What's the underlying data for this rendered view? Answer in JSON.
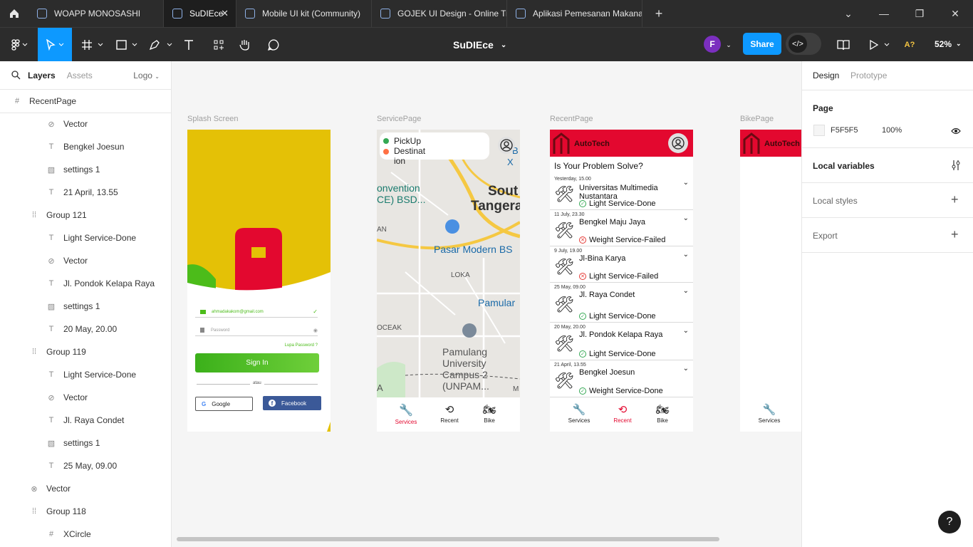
{
  "tabs": [
    {
      "label": "WOAPP MONOSASHI",
      "active": false
    },
    {
      "label": "SuDIEce",
      "active": true
    },
    {
      "label": "Mobile UI kit (Community)",
      "active": false
    },
    {
      "label": "GOJEK UI Design - Online Tra",
      "active": false
    },
    {
      "label": "Aplikasi Pemesanan Makanan",
      "active": false
    }
  ],
  "toolbar": {
    "doc_title": "SuDIEce",
    "avatar_initial": "F",
    "share_label": "Share",
    "zoom": "52%",
    "font_warning": "A?"
  },
  "left_panel": {
    "tab_layers": "Layers",
    "tab_assets": "Assets",
    "page_name": "Logo",
    "layers": [
      {
        "label": "RecentPage",
        "icon": "frame-icon",
        "indent": 0
      },
      {
        "label": "Vector",
        "icon": "check-circle-icon",
        "indent": 2
      },
      {
        "label": "Bengkel Joesun",
        "icon": "text-icon",
        "indent": 2
      },
      {
        "label": "settings 1",
        "icon": "image-icon",
        "indent": 2
      },
      {
        "label": "21 April, 13.55",
        "icon": "text-icon",
        "indent": 2
      },
      {
        "label": "Group 121",
        "icon": "group-icon",
        "indent": 1
      },
      {
        "label": "Light Service-Done",
        "icon": "text-icon",
        "indent": 2
      },
      {
        "label": "Vector",
        "icon": "check-circle-icon",
        "indent": 2
      },
      {
        "label": "Jl. Pondok Kelapa Raya",
        "icon": "text-icon",
        "indent": 2
      },
      {
        "label": "settings 1",
        "icon": "image-icon",
        "indent": 2
      },
      {
        "label": "20 May, 20.00",
        "icon": "text-icon",
        "indent": 2
      },
      {
        "label": "Group 119",
        "icon": "group-icon",
        "indent": 1
      },
      {
        "label": "Light Service-Done",
        "icon": "text-icon",
        "indent": 2
      },
      {
        "label": "Vector",
        "icon": "check-circle-icon",
        "indent": 2
      },
      {
        "label": "Jl. Raya Condet",
        "icon": "text-icon",
        "indent": 2
      },
      {
        "label": "settings 1",
        "icon": "image-icon",
        "indent": 2
      },
      {
        "label": "25 May, 09.00",
        "icon": "text-icon",
        "indent": 2
      },
      {
        "label": "Vector",
        "icon": "x-circle-icon",
        "indent": 1
      },
      {
        "label": "Group 118",
        "icon": "group-icon",
        "indent": 1
      },
      {
        "label": "XCircle",
        "icon": "frame-icon",
        "indent": 2
      }
    ]
  },
  "canvas": {
    "frame_labels": [
      "Splash Screen",
      "ServicePage",
      "RecentPage",
      "BikePage"
    ],
    "splash": {
      "email": "ahmadakakom@gmail.com",
      "password_placeholder": "Password",
      "forgot": "Lupa Password ?",
      "sign_in": "Sign In",
      "divider": "atau",
      "google": "Google",
      "facebook": "Facebook"
    },
    "service": {
      "pickup": "PickUp",
      "destination": "Destinat ion",
      "map_labels": [
        "Sout",
        "Tangera",
        "onvention CE) BSD...",
        "Pasar Modern BS",
        "LOKA",
        "Pamular",
        "OCEAK",
        "Pamulang University Campus 2 (UNPAM...",
        "AN",
        "B",
        "X",
        "A",
        "M"
      ],
      "nav": [
        "Services",
        "Recent",
        "Bike"
      ]
    },
    "recent": {
      "brand": "AutoTech",
      "heading": "Is Your Problem Solve?",
      "items": [
        {
          "date": "Yesterday, 15.00",
          "title": "Universitas Multimedia Nustantara",
          "status": "Light Service-Done",
          "ok": true
        },
        {
          "date": "11 July, 23.30",
          "title": "Bengkel Maju Jaya",
          "status": "Weight Service-Failed",
          "ok": false
        },
        {
          "date": "9 July, 19.00",
          "title": "Jl-Bina Karya",
          "status": "Light Service-Failed",
          "ok": false
        },
        {
          "date": "25 May, 09.00",
          "title": "Jl. Raya Condet",
          "status": "Light Service-Done",
          "ok": true
        },
        {
          "date": "20 May, 20.00",
          "title": "Jl. Pondok Kelapa Raya",
          "status": "Light Service-Done",
          "ok": true
        },
        {
          "date": "21 April, 13.55",
          "title": "Bengkel Joesun",
          "status": "Weight Service-Done",
          "ok": true
        }
      ],
      "nav": [
        "Services",
        "Recent",
        "Bike"
      ]
    },
    "bike": {
      "brand": "AutoTech",
      "nav": [
        "Services"
      ]
    }
  },
  "right_panel": {
    "tab_design": "Design",
    "tab_prototype": "Prototype",
    "page_heading": "Page",
    "page_color": "F5F5F5",
    "page_opacity": "100%",
    "local_variables": "Local variables",
    "local_styles": "Local styles",
    "export": "Export"
  },
  "help": "?",
  "colors": {
    "accent": "#0d99ff",
    "brand_red": "#e3082f",
    "splash_yellow": "#e4c106",
    "signin_green": "#4cbc1a",
    "facebook_blue": "#3b5998"
  }
}
